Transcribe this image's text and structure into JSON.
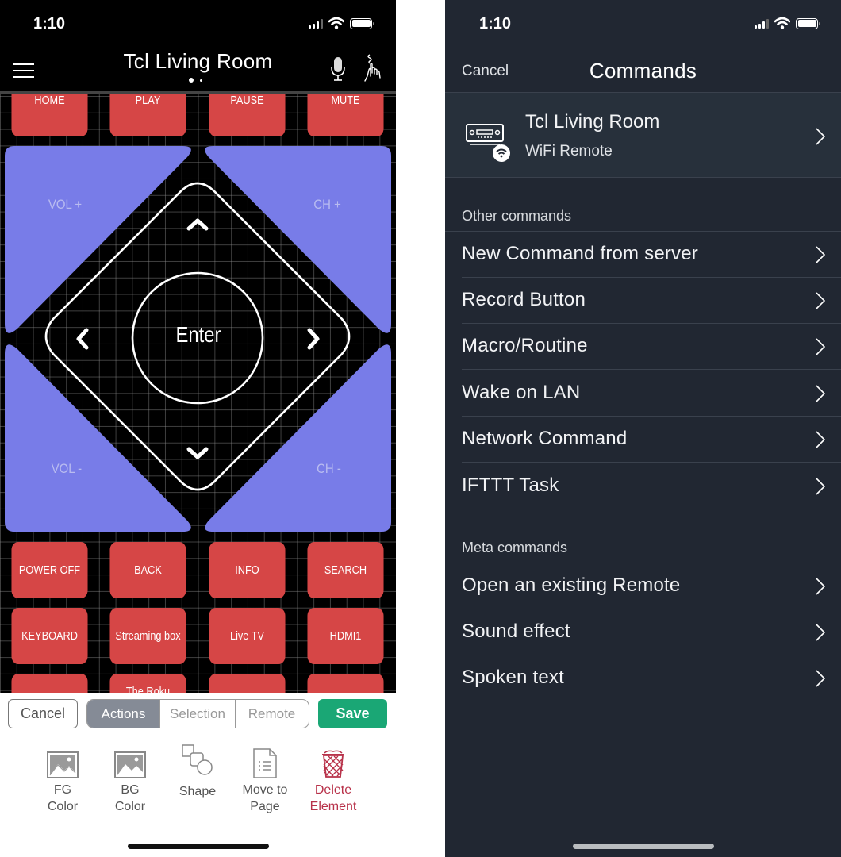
{
  "left_phone": {
    "status_bar": {
      "time": "1:10"
    },
    "header": {
      "title": "Tcl Living Room",
      "page_count": 2,
      "active_page": 1
    },
    "remote": {
      "top_row": [
        "HOME",
        "PLAY",
        "PAUSE",
        "MUTE"
      ],
      "dpad": {
        "vol_up": "VOL +",
        "ch_up": "CH +",
        "vol_down": "VOL -",
        "ch_down": "CH -",
        "enter": "Enter"
      },
      "row_1": [
        "POWER OFF",
        "BACK",
        "INFO",
        "SEARCH"
      ],
      "row_2": [
        "KEYBOARD",
        "Streaming box",
        "Live TV",
        "HDMI1"
      ],
      "row_3": [
        "",
        "The Roku",
        "",
        ""
      ],
      "colors": {
        "button_red": "#d64646",
        "dpad_blue": "#787ce8",
        "canvas": "#000000"
      }
    },
    "edit_bar": {
      "cancel_label": "Cancel",
      "segments": [
        {
          "label": "Actions",
          "active": true
        },
        {
          "label": "Selection",
          "active": false
        },
        {
          "label": "Remote",
          "active": false
        }
      ],
      "save_label": "Save",
      "save_color": "#1aa775",
      "tools": [
        {
          "icon": "fg-color-image-icon",
          "line1": "FG",
          "line2": "Color"
        },
        {
          "icon": "bg-color-image-icon",
          "line1": "BG",
          "line2": "Color"
        },
        {
          "icon": "shape-icon",
          "line1": "Shape",
          "line2": ""
        },
        {
          "icon": "move-to-page-document-icon",
          "line1": "Move to",
          "line2": "Page"
        },
        {
          "icon": "trash-icon",
          "line1": "Delete",
          "line2": "Element"
        }
      ],
      "danger_color": "#b8324a"
    }
  },
  "right_phone": {
    "status_bar": {
      "time": "1:10"
    },
    "nav": {
      "cancel_label": "Cancel",
      "title": "Commands"
    },
    "remote_row": {
      "name": "Tcl Living Room",
      "type": "WiFi Remote",
      "icon": "wifi-device-icon"
    },
    "sections": [
      {
        "header": "Other commands",
        "items": [
          "New Command from server",
          "Record Button",
          "Macro/Routine",
          "Wake on LAN",
          "Network Command",
          "IFTTT Task"
        ]
      },
      {
        "header": "Meta commands",
        "items": [
          "Open an existing Remote",
          "Sound effect",
          "Spoken text"
        ]
      }
    ],
    "colors": {
      "background": "#212732",
      "row_highlight": "#27303b"
    }
  }
}
